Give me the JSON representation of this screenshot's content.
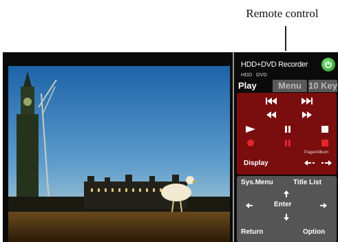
{
  "callout": {
    "label": "Remote control"
  },
  "remote": {
    "title": "HDD+DVD Recorder",
    "sources": [
      "HDD",
      "DVD"
    ],
    "tabs": [
      "Play",
      "Menu",
      "10 Key"
    ],
    "page_album_label": "Page/Album",
    "display_label": "Display",
    "sys_menu_label": "Sys.Menu",
    "title_list_label": "Title List",
    "enter_label": "Enter",
    "return_label": "Return",
    "option_label": "Option"
  },
  "colors": {
    "record_red": "#e3262b",
    "power_green": "#2fb52f",
    "panel_red": "#7a0d0d",
    "panel_gray": "#555555"
  }
}
